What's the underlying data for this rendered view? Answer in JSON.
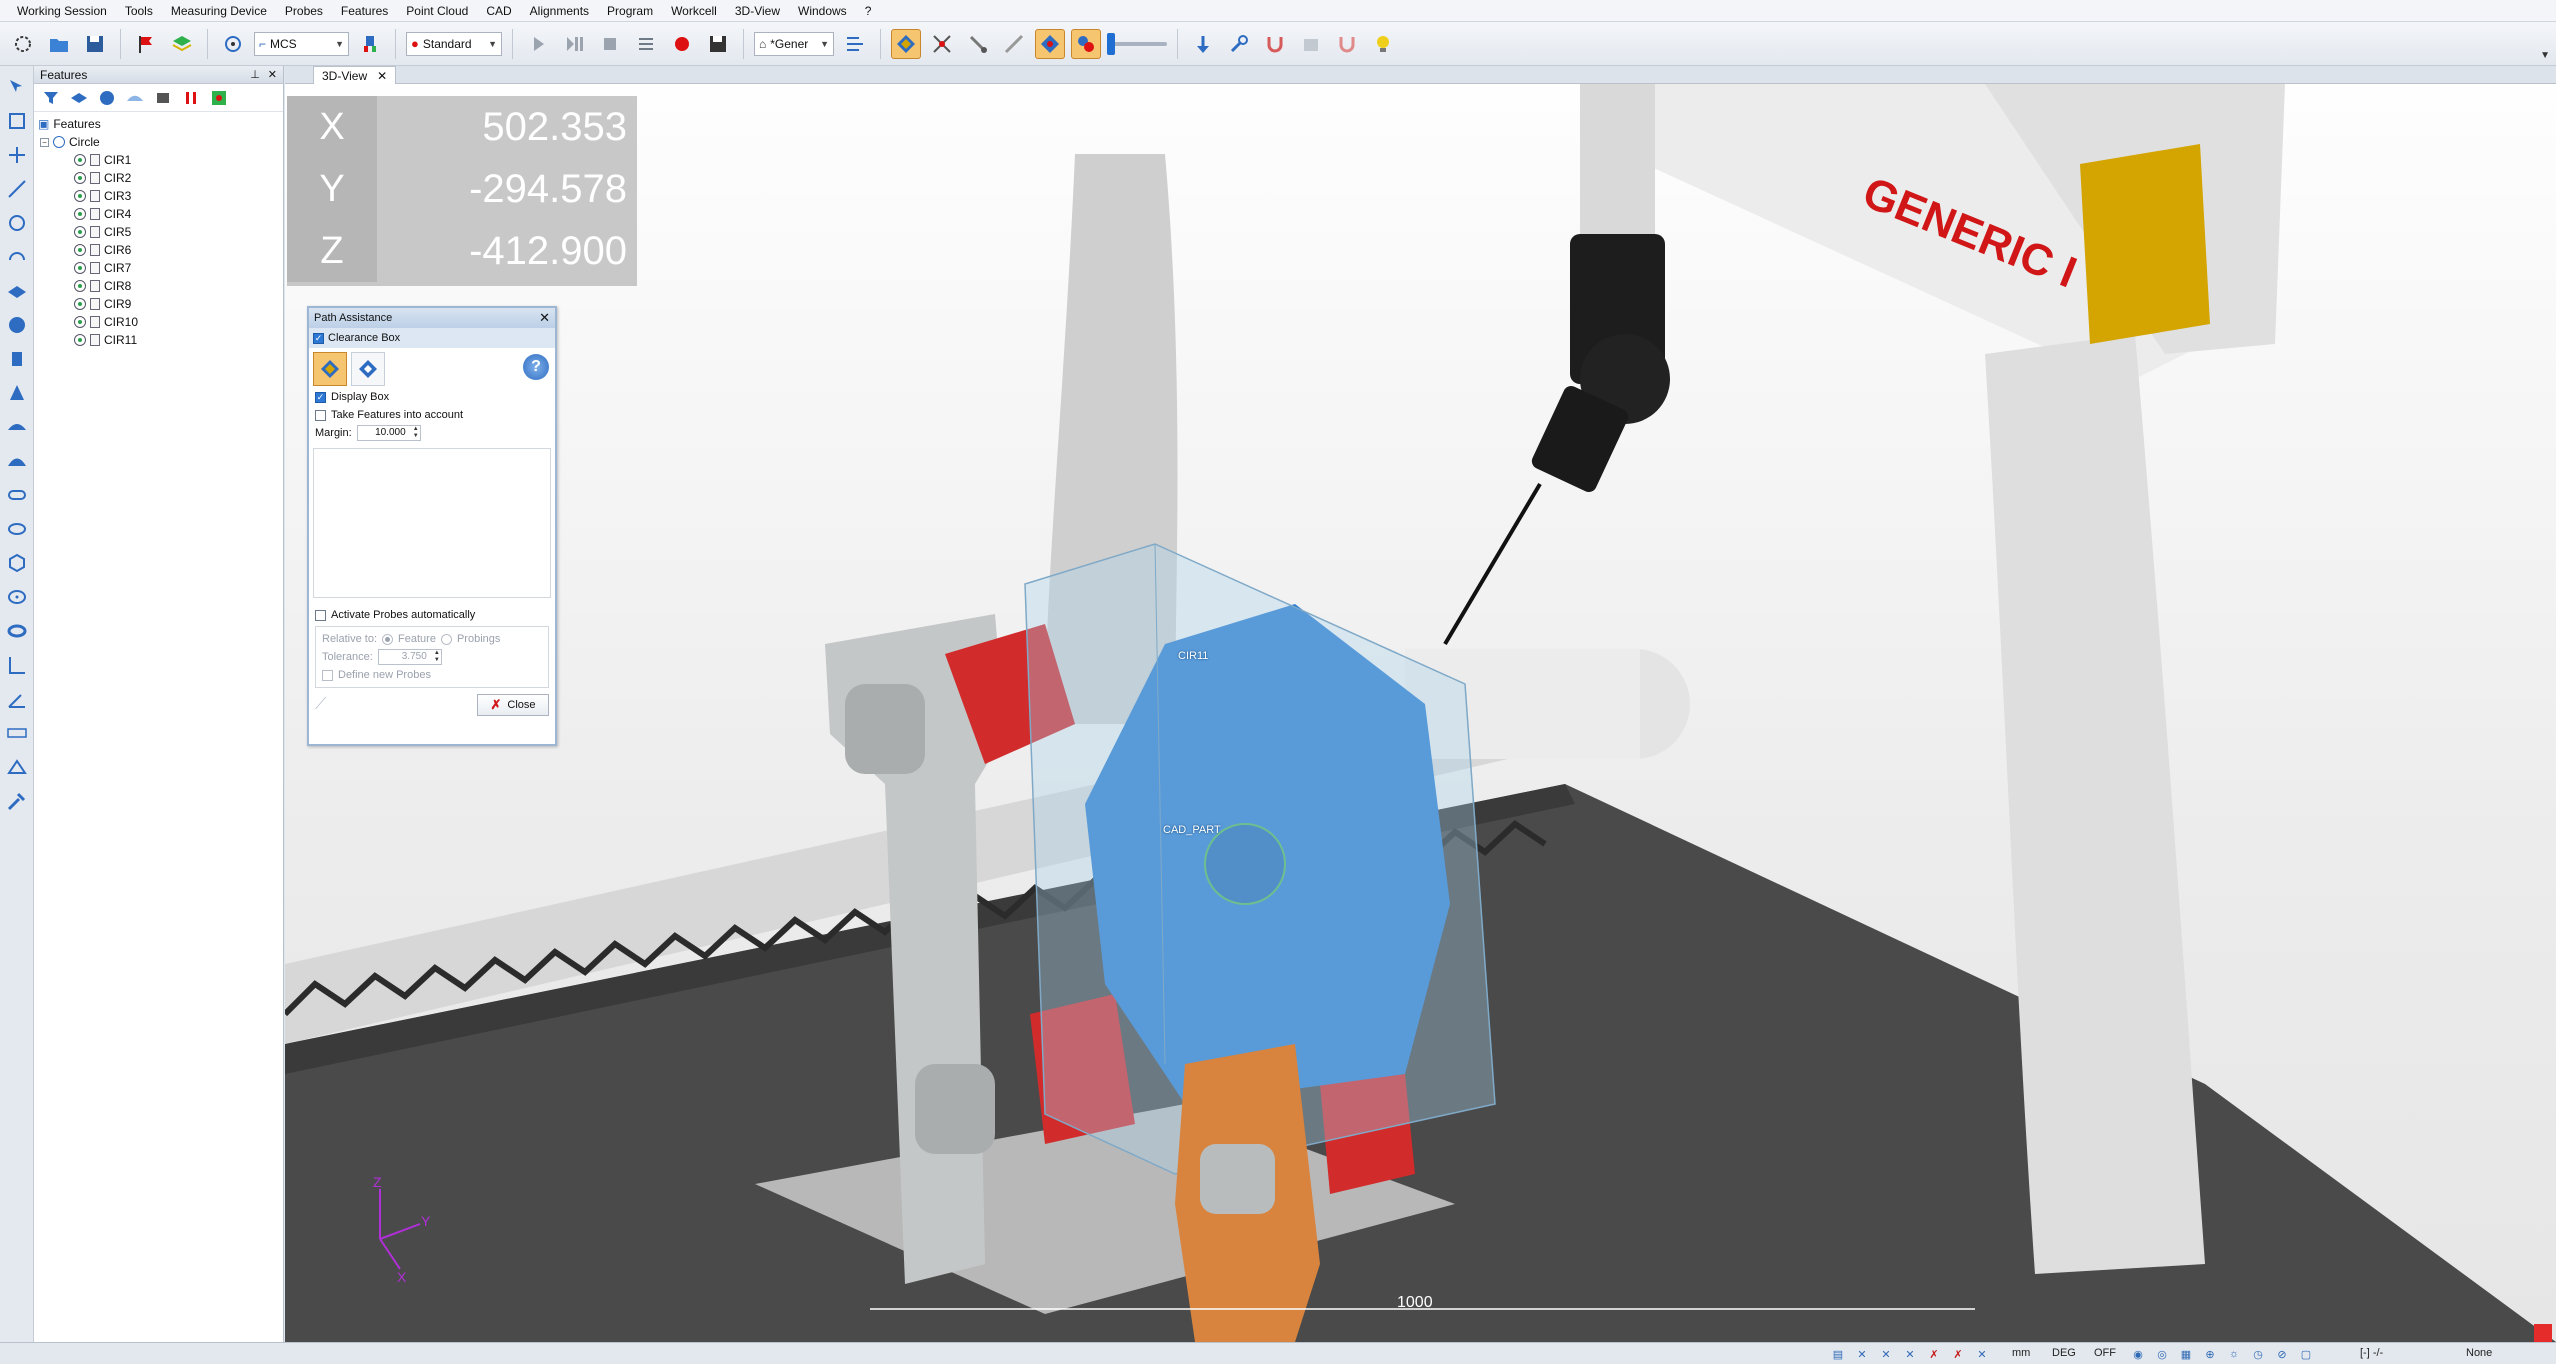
{
  "menu": [
    "Working Session",
    "Tools",
    "Measuring Device",
    "Probes",
    "Features",
    "Point Cloud",
    "CAD",
    "Alignments",
    "Program",
    "Workcell",
    "3D-View",
    "Windows",
    "?"
  ],
  "toolbar": {
    "coord_system": "MCS",
    "mode": "Standard",
    "machine": "*Gener"
  },
  "features_panel": {
    "title": "Features",
    "root": "Features",
    "group": "Circle",
    "items": [
      "CIR1",
      "CIR2",
      "CIR3",
      "CIR4",
      "CIR5",
      "CIR6",
      "CIR7",
      "CIR8",
      "CIR9",
      "CIR10",
      "CIR11"
    ]
  },
  "view_tab": "3D-View",
  "dro": {
    "x_label": "X",
    "x_value": "502.353",
    "y_label": "Y",
    "y_value": "-294.578",
    "z_label": "Z",
    "z_value": "-412.900"
  },
  "path_dialog": {
    "title": "Path Assistance",
    "clearance_box": "Clearance Box",
    "display_box": "Display Box",
    "take_features": "Take Features into account",
    "margin_label": "Margin:",
    "margin_value": "10.000",
    "activate_probes": "Activate Probes automatically",
    "relative_to": "Relative to:",
    "feature_option": "Feature",
    "probings_option": "Probings",
    "tolerance_label": "Tolerance:",
    "tolerance_value": "3.750",
    "define_probes": "Define new Probes",
    "close_label": "Close"
  },
  "scene": {
    "cmm_brand": "GENERIC I",
    "feature_label": "CIR11",
    "part_label": "CAD_PART",
    "scale_value": "1000",
    "axis_y": "Y",
    "axis_x": "X",
    "axis_z": "Z"
  },
  "status": {
    "units": "mm",
    "angle": "DEG",
    "state": "OFF",
    "value_readout": "[-] -/-",
    "selection": "None"
  },
  "colors": {
    "part_blue": "#2f7fd0",
    "fixture_red": "#d12b2b",
    "fixture_orange": "#d8843f",
    "brand_red": "#d01616",
    "head_yellow": "#d4a400"
  }
}
